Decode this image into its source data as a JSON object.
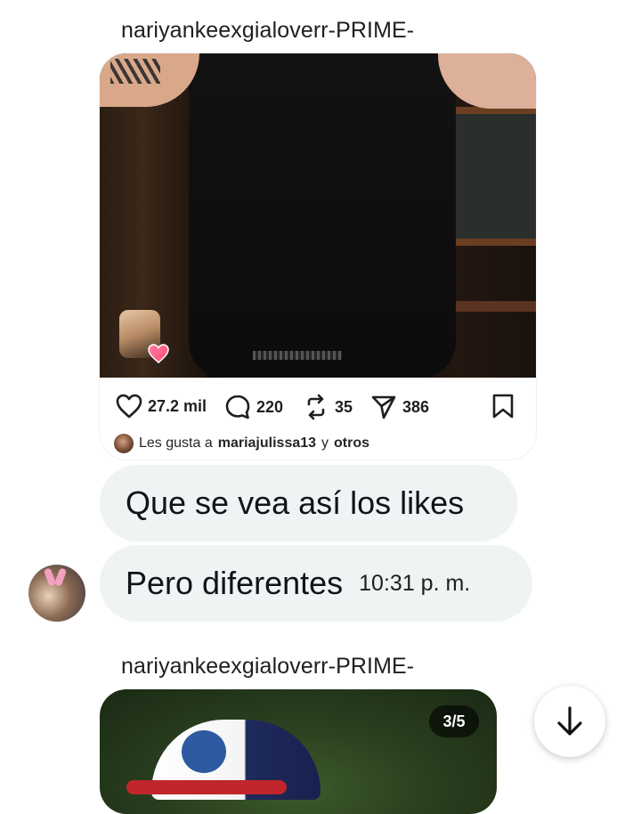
{
  "messages": {
    "sender_1": "nariyankeexgialoverr-PRIME-",
    "post_1": {
      "likes": "27.2 mil",
      "comments": "220",
      "reposts": "35",
      "shares": "386",
      "liked_by_prefix": "Les gusta a",
      "liked_by_user": "mariajulissa13",
      "liked_by_mid": "y",
      "liked_by_suffix": "otros"
    },
    "bubble_1": "Que se vea así los likes",
    "bubble_2": "Pero diferentes",
    "bubble_2_time": "10:31 p. m.",
    "sender_2": "nariyankeexgialoverr-PRIME-",
    "post_2": {
      "counter": "3/5"
    }
  },
  "icons": {
    "like": "heart-icon",
    "comment": "comment-icon",
    "repost": "repost-icon",
    "share": "send-icon",
    "save": "bookmark-icon",
    "scroll": "arrow-down-icon"
  }
}
